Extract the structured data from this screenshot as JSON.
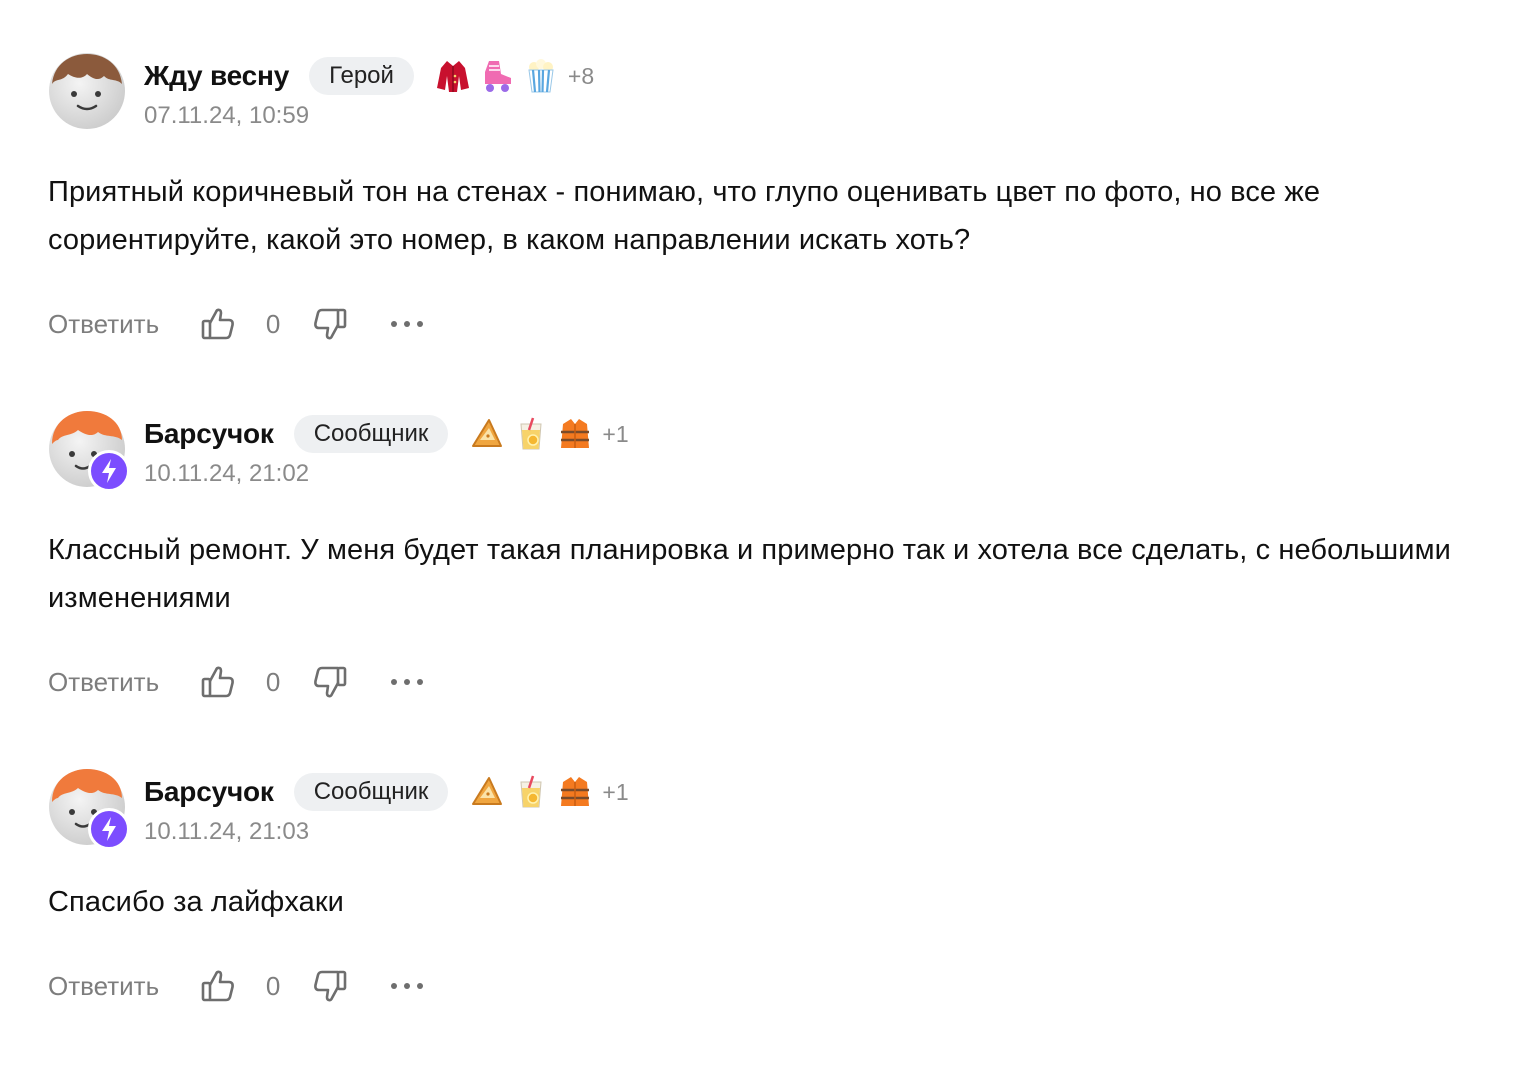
{
  "comments": [
    {
      "author": "Жду весну",
      "tag": "Герой",
      "achievements": [
        "red-coat-icon",
        "roller-skate-icon",
        "popcorn-icon"
      ],
      "achievements_more": "+8",
      "date": "07.11.24, 10:59",
      "text": "Приятный коричневый тон на стенах - понимаю, что глупо оценивать цвет по фото, но все же сориентируйте, какой это номер, в каком направлении искать хоть?",
      "reply_label": "Ответить",
      "likes": "0",
      "avatar_hair_color": "#8b5a3c",
      "has_pro_badge": false
    },
    {
      "author": "Барсучок",
      "tag": "Сообщник",
      "achievements": [
        "pastry-icon",
        "lemonade-icon",
        "life-vest-icon"
      ],
      "achievements_more": "+1",
      "date": "10.11.24, 21:02",
      "text": "Классный ремонт. У меня будет такая планировка и примерно так и хотела все сделать, с небольшими изменениями",
      "reply_label": "Ответить",
      "likes": "0",
      "avatar_hair_color": "#f07a3c",
      "has_pro_badge": true
    },
    {
      "author": "Барсучок",
      "tag": "Сообщник",
      "achievements": [
        "pastry-icon",
        "lemonade-icon",
        "life-vest-icon"
      ],
      "achievements_more": "+1",
      "date": "10.11.24, 21:03",
      "text": "Спасибо за лайфхаки",
      "reply_label": "Ответить",
      "likes": "0",
      "avatar_hair_color": "#f07a3c",
      "has_pro_badge": true
    }
  ],
  "colors": {
    "text": "#111111",
    "muted": "#8a8a8a",
    "tag_bg": "#eef0f2",
    "pro_badge": "#7c4dff"
  }
}
